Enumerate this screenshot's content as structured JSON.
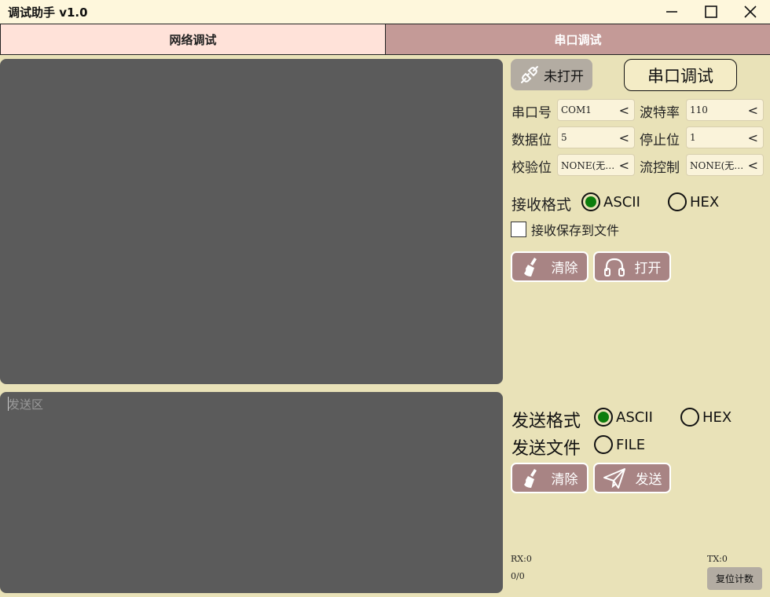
{
  "window": {
    "title": "调试助手 v1.0",
    "controls": [
      "minimize-icon",
      "maximize-icon",
      "close-icon"
    ]
  },
  "tabs": [
    {
      "label": "网络调试",
      "active": false
    },
    {
      "label": "串口调试",
      "active": true
    }
  ],
  "status": {
    "label": "未打开",
    "icon": "plug-disconnected-icon"
  },
  "mode_button": {
    "label": "串口调试"
  },
  "serial": {
    "port": {
      "label": "串口号",
      "value": "COM1"
    },
    "baud": {
      "label": "波特率",
      "value": "110"
    },
    "data_bits": {
      "label": "数据位",
      "value": "5"
    },
    "stop_bits": {
      "label": "停止位",
      "value": "1"
    },
    "parity": {
      "label": "校验位",
      "value": "NONE(无…"
    },
    "flow": {
      "label": "流控制",
      "value": "NONE(无…"
    },
    "dropdown_arrow": "<"
  },
  "receive": {
    "format_label": "接收格式",
    "ascii": "ASCII",
    "hex": "HEX",
    "selected": "ASCII",
    "save_to_file": "接收保存到文件",
    "save_checked": false,
    "clear_button": "清除",
    "open_button": "打开"
  },
  "send": {
    "placeholder": "发送区",
    "format_label": "发送格式",
    "ascii": "ASCII",
    "hex": "HEX",
    "selected": "ASCII",
    "file_label": "发送文件",
    "file_option": "FILE",
    "clear_button": "清除",
    "send_button": "发送"
  },
  "counters": {
    "rx": "RX:0",
    "tx": "TX:0",
    "ratio": "0/0",
    "reset_button": "复位计数"
  },
  "colors": {
    "background": "#e9e2b8",
    "text_area": "#5b5b5b",
    "active_tab": "#c49a97",
    "inactive_tab": "#ffe2d9",
    "action_button": "#a88484",
    "radio_on": "#0c7d0c"
  }
}
